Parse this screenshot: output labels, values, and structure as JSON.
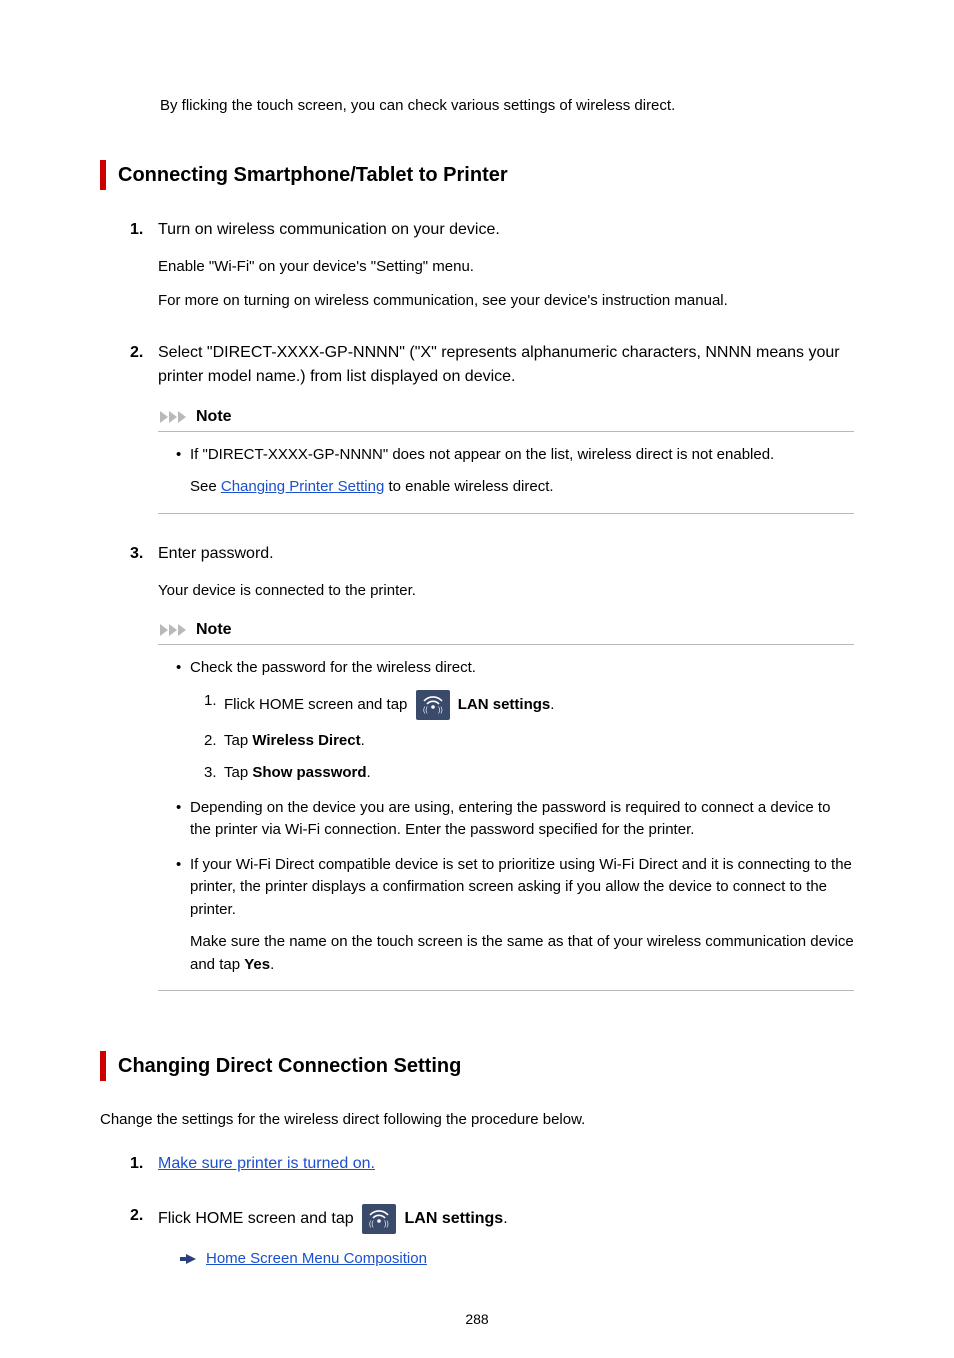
{
  "intro": "By flicking the touch screen, you can check various settings of wireless direct.",
  "heading1": "Connecting Smartphone/Tablet to Printer",
  "s1": {
    "step1_title": "Turn on wireless communication on your device.",
    "step1_p1": "Enable \"Wi-Fi\" on your device's \"Setting\" menu.",
    "step1_p2": "For more on turning on wireless communication, see your device's instruction manual.",
    "step2_title": "Select \"DIRECT-XXXX-GP-NNNN\" (\"X\" represents alphanumeric characters, NNNN means your printer model name.) from list displayed on device.",
    "note_label": "Note",
    "step2_note_bullet1": "If \"DIRECT-XXXX-GP-NNNN\" does not appear on the list, wireless direct is not enabled.",
    "step2_note_see_prefix": "See ",
    "step2_note_link": "Changing Printer Setting",
    "step2_note_see_suffix": " to enable wireless direct.",
    "step3_title": "Enter password.",
    "step3_p1": "Your device is connected to the printer.",
    "step3_bullet1": "Check the password for the wireless direct.",
    "step3_inner1_pre": "Flick HOME screen and tap ",
    "step3_inner1_post_bold": "LAN settings",
    "step3_inner1_post_period": ".",
    "step3_inner2_pre": "Tap ",
    "step3_inner2_bold": "Wireless Direct",
    "step3_inner2_period": ".",
    "step3_inner3_pre": "Tap ",
    "step3_inner3_bold": "Show password",
    "step3_inner3_period": ".",
    "step3_bullet2": "Depending on the device you are using, entering the password is required to connect a device to the printer via Wi-Fi connection. Enter the password specified for the printer.",
    "step3_bullet3": "If your Wi-Fi Direct compatible device is set to prioritize using Wi-Fi Direct and it is connecting to the printer, the printer displays a confirmation screen asking if you allow the device to connect to the printer.",
    "step3_bullet3_p2a": "Make sure the name on the touch screen is the same as that of your wireless communication device and tap ",
    "step3_bullet3_p2b": "Yes",
    "step3_bullet3_p2c": "."
  },
  "heading2": "Changing Direct Connection Setting",
  "s2": {
    "body": "Change the settings for the wireless direct following the procedure below.",
    "step1_link": "Make sure printer is turned on.",
    "step2_pre": "Flick HOME screen and tap ",
    "step2_bold": "LAN settings",
    "step2_period": ".",
    "arrow_link": "Home Screen Menu Composition"
  },
  "page_number": "288"
}
